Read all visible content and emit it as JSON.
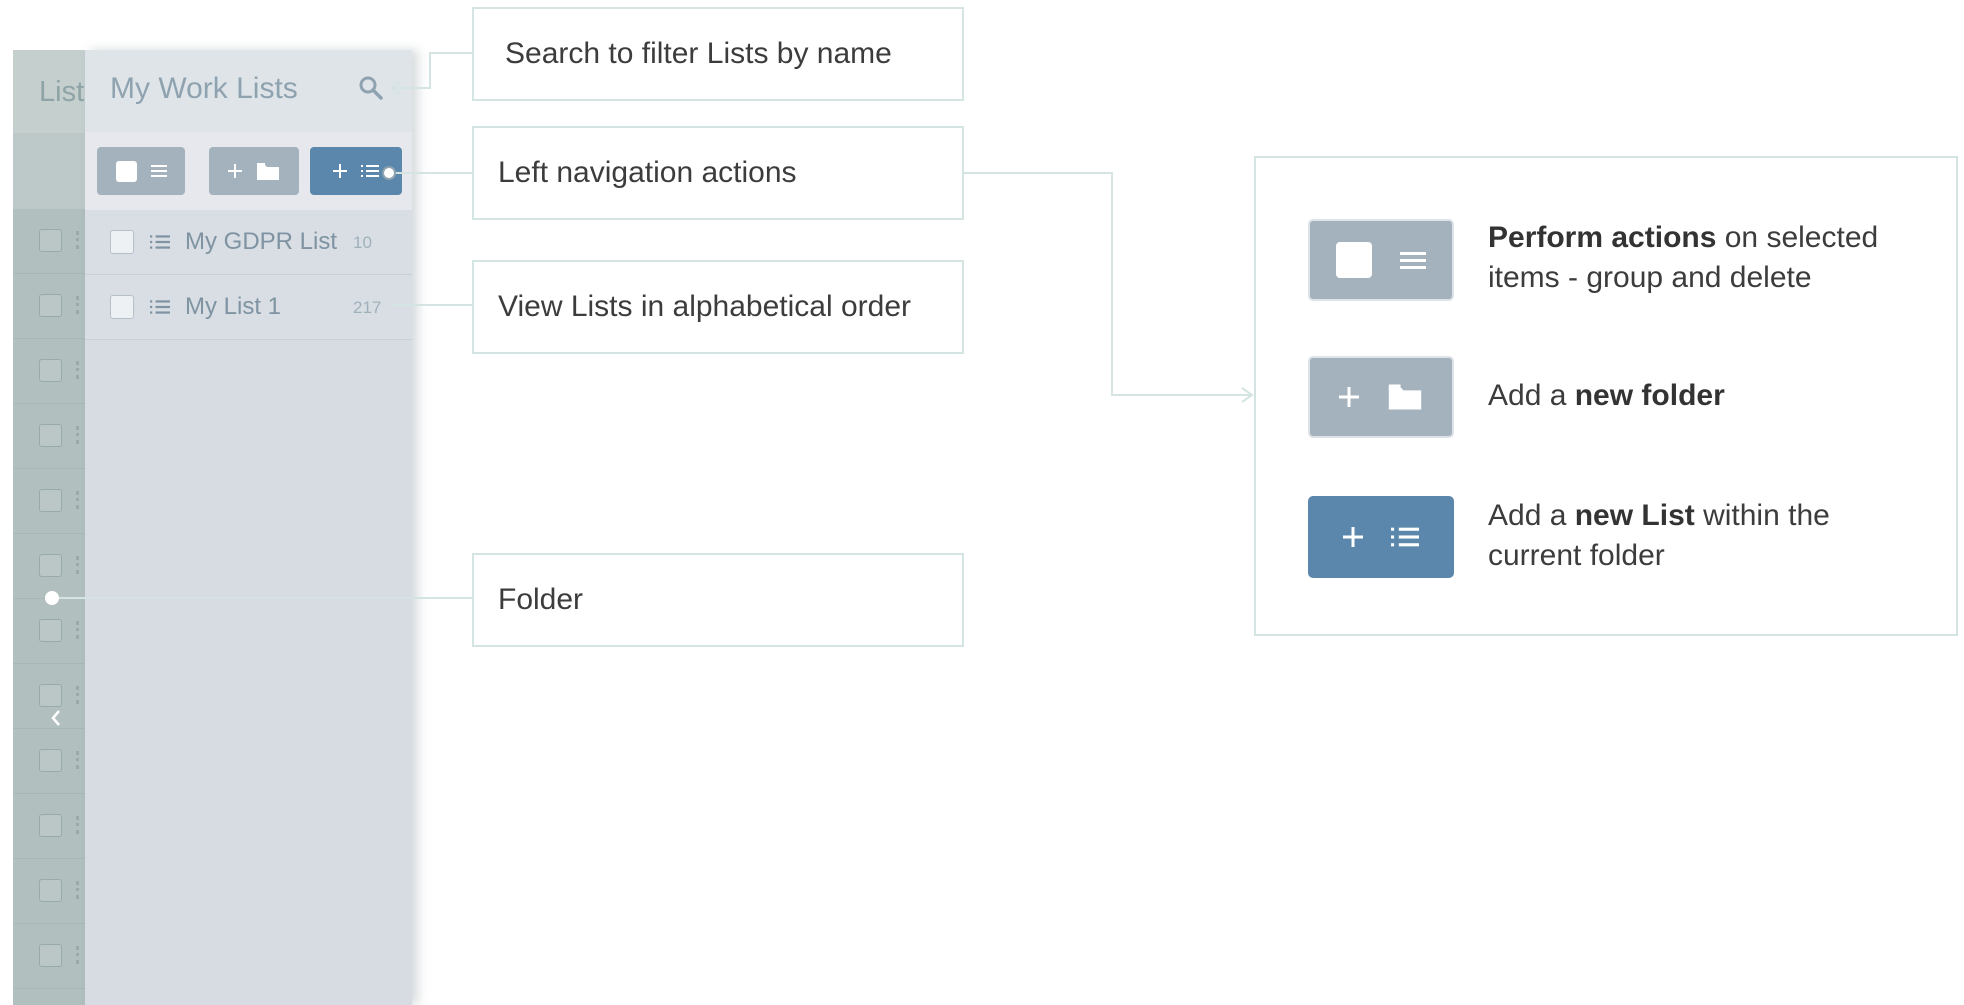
{
  "background_app": {
    "title_fragment": "List"
  },
  "panel": {
    "title": "My Work Lists",
    "lists": [
      {
        "name": "My GDPR List",
        "count": "10"
      },
      {
        "name": "My List 1",
        "count": "217"
      }
    ]
  },
  "callouts": {
    "search": "Search to filter Lists by name",
    "nav_actions": "Left navigation actions",
    "alphabetical": "View Lists in alphabetical order",
    "folder": "Folder"
  },
  "legend": {
    "item1_bold": "Perform actions",
    "item1_rest1": " on selected",
    "item1_rest2": "items - group and delete",
    "item2_pre": "Add a ",
    "item2_bold": "new folder",
    "item3_pre": "Add a ",
    "item3_bold": "new List",
    "item3_rest1": " within the",
    "item3_rest2": "current folder"
  },
  "icons": {
    "search": "search-icon",
    "select_all": "checkbox-icon",
    "menu": "menu-icon",
    "add": "plus-icon",
    "folder": "folder-icon",
    "list": "list-icon",
    "collapse": "chevron-left-icon"
  },
  "colors": {
    "primary_button": "#5a87ab",
    "secondary_button": "#a3b2bd",
    "callout_border": "#d4e4e2"
  }
}
